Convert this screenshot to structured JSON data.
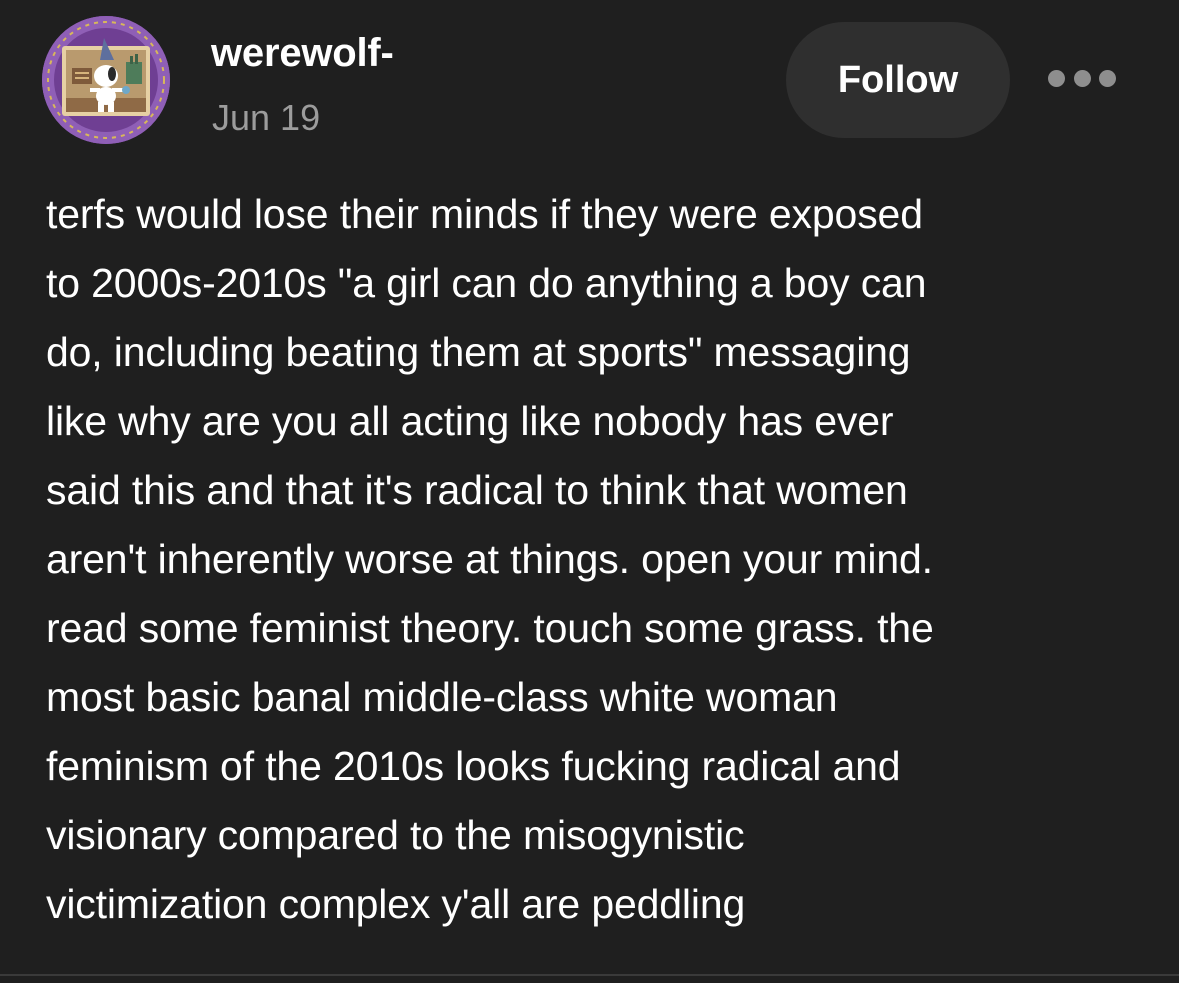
{
  "post": {
    "author": {
      "username": "werewolf-",
      "date": "Jun 19",
      "avatar_icon": "avatar-illustration"
    },
    "actions": {
      "follow_label": "Follow",
      "more_icon": "ellipsis-icon"
    },
    "body_lines": [
      "terfs would lose their minds if they were exposed",
      "to 2000s-2010s \"a girl can do anything a boy can",
      "do, including beating them at sports\" messaging",
      "like why are you all acting like nobody has ever",
      "said this and that it's radical to think that women",
      "aren't inherently worse at things. open your mind.",
      "read some feminist theory. touch some grass. the",
      "most basic banal middle-class white woman",
      "feminism of the 2010s looks fucking radical and",
      "visionary compared to the misogynistic",
      "victimization complex y'all are peddling"
    ]
  },
  "colors": {
    "background": "#1f1f1f",
    "text": "#ffffff",
    "muted_text": "#9c9c9c",
    "button_bg": "#2f2f2f",
    "avatar_ring": "#8f5fb6"
  }
}
